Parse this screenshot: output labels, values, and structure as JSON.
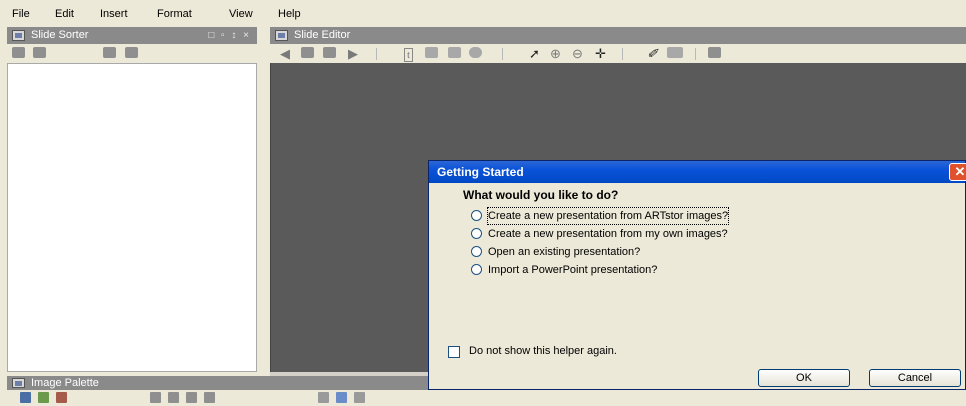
{
  "menu": [
    "File",
    "Edit",
    "Insert",
    "Format",
    "View",
    "Help"
  ],
  "slide_sorter": {
    "title": "Slide Sorter",
    "controls": "□ ▫ ↕ ×"
  },
  "slide_editor": {
    "title": "Slide Editor"
  },
  "image_palette": {
    "title": "Image Palette"
  },
  "dialog": {
    "title": "Getting Started",
    "close_symbol": "✕",
    "question": "What would you like to do?",
    "options": [
      "Create a new presentation from ARTstor images?",
      "Create a new presentation from my own images?",
      "Open an existing presentation?",
      "Import a PowerPoint presentation?"
    ],
    "checkbox_label": "Do not show this helper again.",
    "ok_label": "OK",
    "cancel_label": "Cancel"
  },
  "editor_toolbar": {
    "text_tool_glyph": "t",
    "pointer_glyph": "➚",
    "zoom_in_glyph": "⊕",
    "zoom_out_glyph": "⊖",
    "pan_glyph": "✛",
    "link_glyph": "✐"
  }
}
